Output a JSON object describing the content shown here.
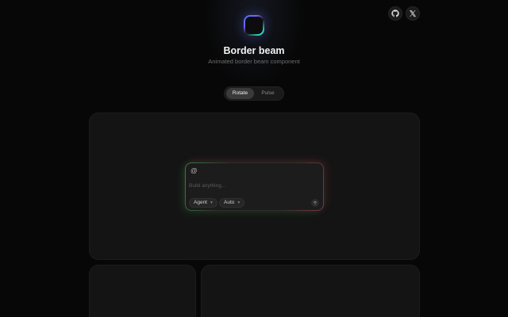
{
  "header": {
    "title": "Border beam",
    "subtitle": "Animated border beam component"
  },
  "social": {
    "github_icon": "github-icon",
    "x_icon": "x-logo-icon"
  },
  "logo_icon": "border-beam-logo-icon",
  "mode_toggle": {
    "options": [
      {
        "label": "Rotate",
        "active": true
      },
      {
        "label": "Pulse",
        "active": false
      }
    ]
  },
  "prompt_card": {
    "mention_icon": "@",
    "placeholder": "Build anything...",
    "value": "",
    "mode_select": "Agent",
    "model_select": "Auto",
    "send_icon": "arrow-up-icon"
  },
  "colors": {
    "background": "#070707",
    "panel": "#141414",
    "beam_green": "#3cc864",
    "beam_red": "#e64664",
    "accent_blue": "#3a7bff"
  }
}
